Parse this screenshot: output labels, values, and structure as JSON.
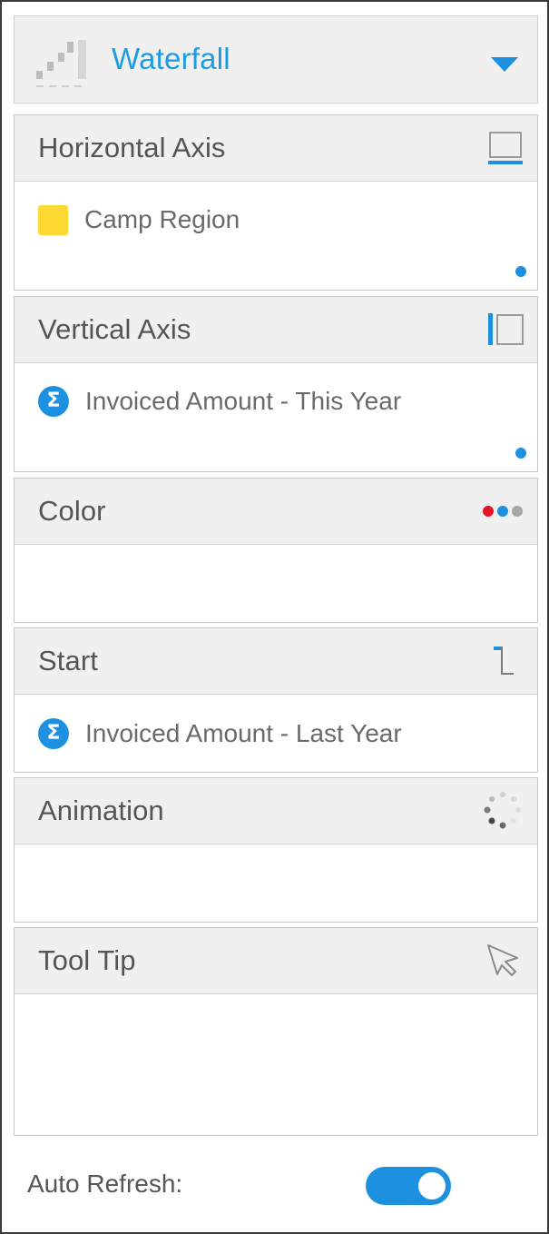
{
  "chart_type": {
    "label": "Waterfall",
    "icon": "waterfall-chart-icon",
    "caret_icon": "chevron-down-icon"
  },
  "sections": {
    "horizontal_axis": {
      "title": "Horizontal Axis",
      "icon": "horizontal-axis-icon",
      "field": {
        "label": "Camp Region",
        "type": "dimension"
      }
    },
    "vertical_axis": {
      "title": "Vertical Axis",
      "icon": "vertical-axis-icon",
      "field": {
        "label": "Invoiced Amount - This Year",
        "type": "metric",
        "symbol": "Σ"
      }
    },
    "color": {
      "title": "Color",
      "icon": "color-dots-icon"
    },
    "start": {
      "title": "Start",
      "icon": "start-marker-icon",
      "field": {
        "label": "Invoiced Amount - Last Year",
        "type": "metric",
        "symbol": "Σ"
      }
    },
    "animation": {
      "title": "Animation",
      "icon": "animation-spinner-icon"
    },
    "tooltip": {
      "title": "Tool Tip",
      "icon": "cursor-arrow-icon"
    }
  },
  "footer": {
    "auto_refresh_label": "Auto Refresh:",
    "auto_refresh_enabled": true
  },
  "colors": {
    "accent": "#1e90e0",
    "dimension": "#ffd933",
    "header_bg": "#f0f0f0",
    "text": "#555555",
    "red_dot": "#e3142a"
  }
}
